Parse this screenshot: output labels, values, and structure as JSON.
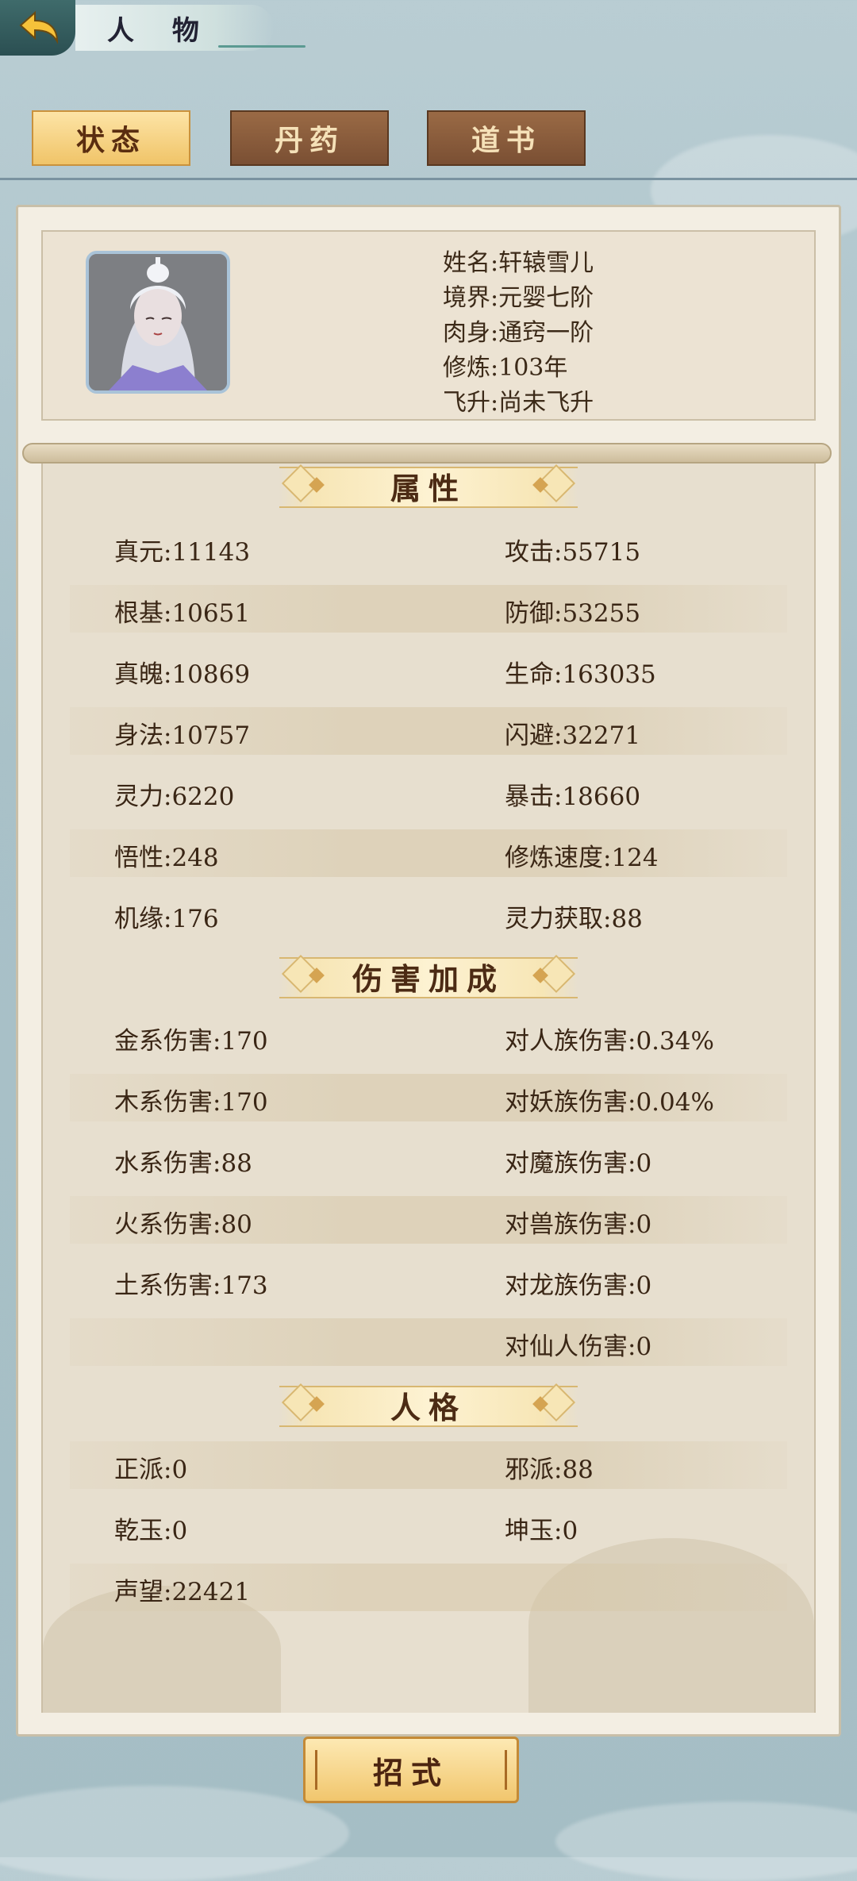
{
  "header": {
    "title": "人 物"
  },
  "tabs": [
    {
      "label": "状态",
      "active": true
    },
    {
      "label": "丹药",
      "active": false
    },
    {
      "label": "道书",
      "active": false
    }
  ],
  "profile": {
    "name": "姓名:轩辕雪儿",
    "realm": "境界:元婴七阶",
    "body": "肉身:通窍一阶",
    "cultivation": "修炼:103年",
    "ascend": "飞升:尚未飞升"
  },
  "sections": {
    "attributes": "属性",
    "damage": "伤害加成",
    "personality": "人格"
  },
  "attributes": [
    [
      "真元:11143",
      "攻击:55715"
    ],
    [
      "根基:10651",
      "防御:53255"
    ],
    [
      "真魄:10869",
      "生命:163035"
    ],
    [
      "身法:10757",
      "闪避:32271"
    ],
    [
      "灵力:6220",
      "暴击:18660"
    ],
    [
      "悟性:248",
      "修炼速度:124"
    ],
    [
      "机缘:176",
      "灵力获取:88"
    ]
  ],
  "damage": [
    [
      "金系伤害:170",
      "对人族伤害:0.34%"
    ],
    [
      "木系伤害:170",
      "对妖族伤害:0.04%"
    ],
    [
      "水系伤害:88",
      "对魔族伤害:0"
    ],
    [
      "火系伤害:80",
      "对兽族伤害:0"
    ],
    [
      "土系伤害:173",
      "对龙族伤害:0"
    ],
    [
      "",
      "对仙人伤害:0"
    ]
  ],
  "personality": [
    [
      "正派:0",
      "邪派:88"
    ],
    [
      "乾玉:0",
      "坤玉:0"
    ],
    [
      "声望:22421",
      ""
    ]
  ],
  "footer": {
    "skill_button": "招式"
  }
}
